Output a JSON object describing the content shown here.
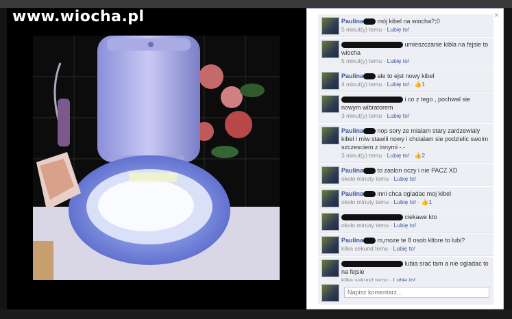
{
  "watermark": "www.wiocha.pl",
  "panel": {
    "close_label": "×",
    "comments": [
      {
        "author": "Paulina",
        "text": "mój kibel na wiocha?;0",
        "time": "5 minut(y) temu",
        "like": "Lubię to!",
        "likes": ""
      },
      {
        "author": "",
        "text": "umieszczanie kibla na fejsie to wiocha",
        "time": "5 minut(y) temu",
        "like": "Lubię to!",
        "likes": ""
      },
      {
        "author": "Paulina",
        "text": "ale to ejst nowy kibel",
        "time": "4 minut(y) temu",
        "like": "Lubię to!",
        "likes": "1"
      },
      {
        "author": "",
        "text": "i co z tego , pochwal sie nowym wibratorem",
        "time": "3 minut(y) temu",
        "like": "Lubię to!",
        "likes": ""
      },
      {
        "author": "Paulina",
        "text": "nop sory ze mialam stary zardzewialy kibel i miw stawili nowy i chcialam sie podzielic swoim szczesciem z innymi -.-",
        "time": "3 minut(y) temu",
        "like": "Lubię to!",
        "likes": "2"
      },
      {
        "author": "Paulina",
        "text": "to zaslon oczy i nie PACZ XD",
        "time": "około minuty temu",
        "like": "Lubię to!",
        "likes": ""
      },
      {
        "author": "Paulina",
        "text": "inni chca ogladac moj kibel",
        "time": "około minuty temu",
        "like": "Lubię to!",
        "likes": "1"
      },
      {
        "author": "",
        "text": "ciekawe kto",
        "time": "około minuty temu",
        "like": "Lubię to!",
        "likes": ""
      },
      {
        "author": "Paulina",
        "text": "m,moze te 8 osob kltore to lubi?",
        "time": "kilka sekund temu",
        "like": "Lubię to!",
        "likes": ""
      },
      {
        "author": "",
        "text": "lubia srać tam a nie ogladac to na fejsie",
        "time": "kilka sekund temu",
        "like": "Lubię to!",
        "likes": ""
      }
    ],
    "composer_placeholder": "Napisz komentarz..."
  },
  "colors": {
    "link": "#3b5998",
    "panel_bg": "#edeff4",
    "backdrop": "#141414"
  }
}
